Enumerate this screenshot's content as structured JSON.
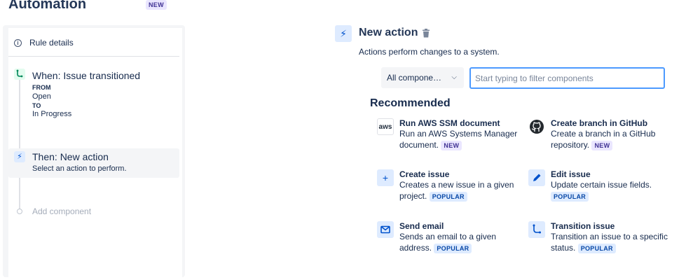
{
  "header": {
    "title": "Automation",
    "badge": "NEW"
  },
  "sidebar": {
    "rule_details_icon": "info-icon",
    "rule_details_label": "Rule details",
    "when": {
      "icon": "branch-icon",
      "title": "When: Issue transitioned",
      "from_label": "FROM",
      "from_value": "Open",
      "to_label": "TO",
      "to_value": "In Progress"
    },
    "then": {
      "icon": "lightning-icon",
      "title": "Then: New action",
      "subtitle": "Select an action to perform."
    },
    "add_component": "Add component"
  },
  "main": {
    "icon": "lightning-icon",
    "title": "New action",
    "description": "Actions perform changes to a system.",
    "select_value": "All compone…",
    "filter_placeholder": "Start typing to filter components",
    "section_title": "Recommended",
    "cards": [
      {
        "icon": "aws-icon",
        "title": "Run AWS SSM document",
        "desc": "Run an AWS Systems Manager document.",
        "badge": "NEW"
      },
      {
        "icon": "github-icon",
        "title": "Create branch in GitHub",
        "desc": "Create a branch in a GitHub repository.",
        "badge": "NEW"
      },
      {
        "icon": "plus-icon",
        "title": "Create issue",
        "desc": "Creates a new issue in a given project.",
        "badge": "POPULAR"
      },
      {
        "icon": "pencil-icon",
        "title": "Edit issue",
        "desc": "Update certain issue fields.",
        "badge": "POPULAR"
      },
      {
        "icon": "envelope-icon",
        "title": "Send email",
        "desc": "Sends an email to a given address.",
        "badge": "POPULAR"
      },
      {
        "icon": "transition-icon",
        "title": "Transition issue",
        "desc": "Transition an issue to a specific status.",
        "badge": "POPULAR"
      }
    ]
  },
  "colors": {
    "accent": "#0052cc",
    "focus_border": "#4c9aff",
    "new_badge": "#eae6ff",
    "popular_badge": "#deebff"
  }
}
